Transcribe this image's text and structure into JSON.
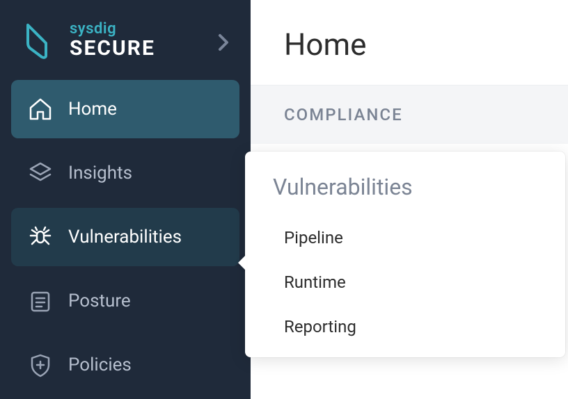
{
  "brand": {
    "name": "sysdig",
    "product": "SECURE"
  },
  "sidebar": {
    "items": [
      {
        "label": "Home"
      },
      {
        "label": "Insights"
      },
      {
        "label": "Vulnerabilities"
      },
      {
        "label": "Posture"
      },
      {
        "label": "Policies"
      }
    ]
  },
  "main": {
    "title": "Home",
    "section_label": "COMPLIANCE"
  },
  "flyout": {
    "title": "Vulnerabilities",
    "items": [
      {
        "label": "Pipeline"
      },
      {
        "label": "Runtime"
      },
      {
        "label": "Reporting"
      }
    ]
  }
}
